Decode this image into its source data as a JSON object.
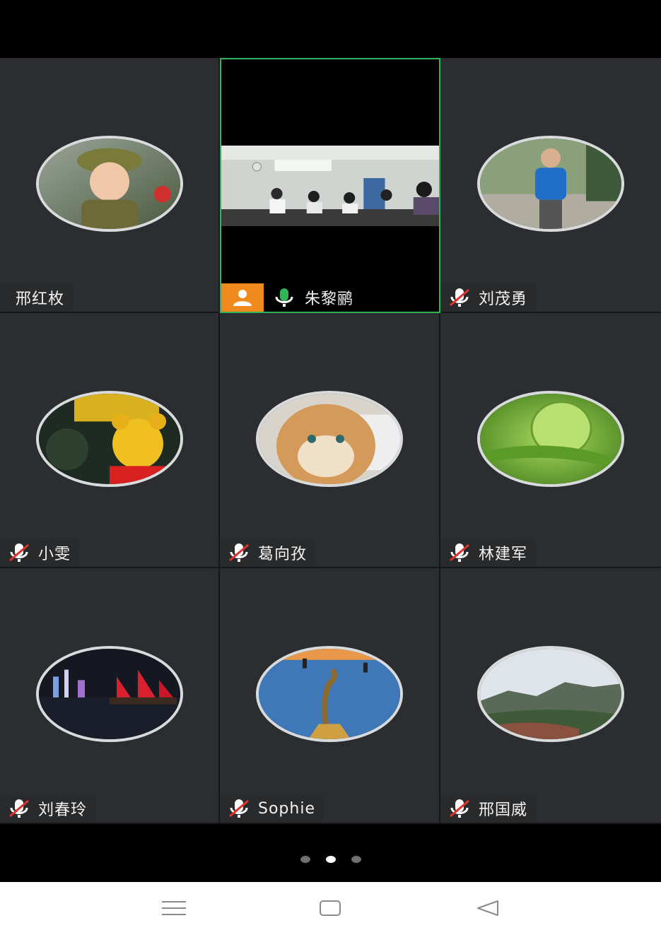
{
  "participants": [
    {
      "name": "邢红枚",
      "mic": "none",
      "avatar": "child-soldier-photo"
    },
    {
      "name": "朱黎鹂",
      "mic": "on",
      "avatar": "video-meeting-room",
      "speaking": true
    },
    {
      "name": "刘茂勇",
      "mic": "muted",
      "avatar": "man-blue-shirt-photo"
    },
    {
      "name": "小雯",
      "mic": "muted",
      "avatar": "winnie-the-pooh-photo"
    },
    {
      "name": "葛向孜",
      "mic": "muted",
      "avatar": "cat-photo"
    },
    {
      "name": "林建军",
      "mic": "muted",
      "avatar": "green-bud-photo"
    },
    {
      "name": "刘春玲",
      "mic": "muted",
      "avatar": "harbor-night-photo"
    },
    {
      "name": "Sophie",
      "mic": "muted",
      "avatar": "golden-statue-photo"
    },
    {
      "name": "邢国威",
      "mic": "muted",
      "avatar": "mountain-landscape-photo"
    }
  ],
  "pager": {
    "count": 3,
    "active": 1
  },
  "navbar": {
    "icons": [
      "menu-icon",
      "home-square-icon",
      "back-triangle-icon"
    ]
  },
  "colors": {
    "tile_bg": "#2b2d30",
    "speaking_border": "#2fb45a",
    "badge_orange": "#f08a1c",
    "mute_red": "#e0322c"
  }
}
